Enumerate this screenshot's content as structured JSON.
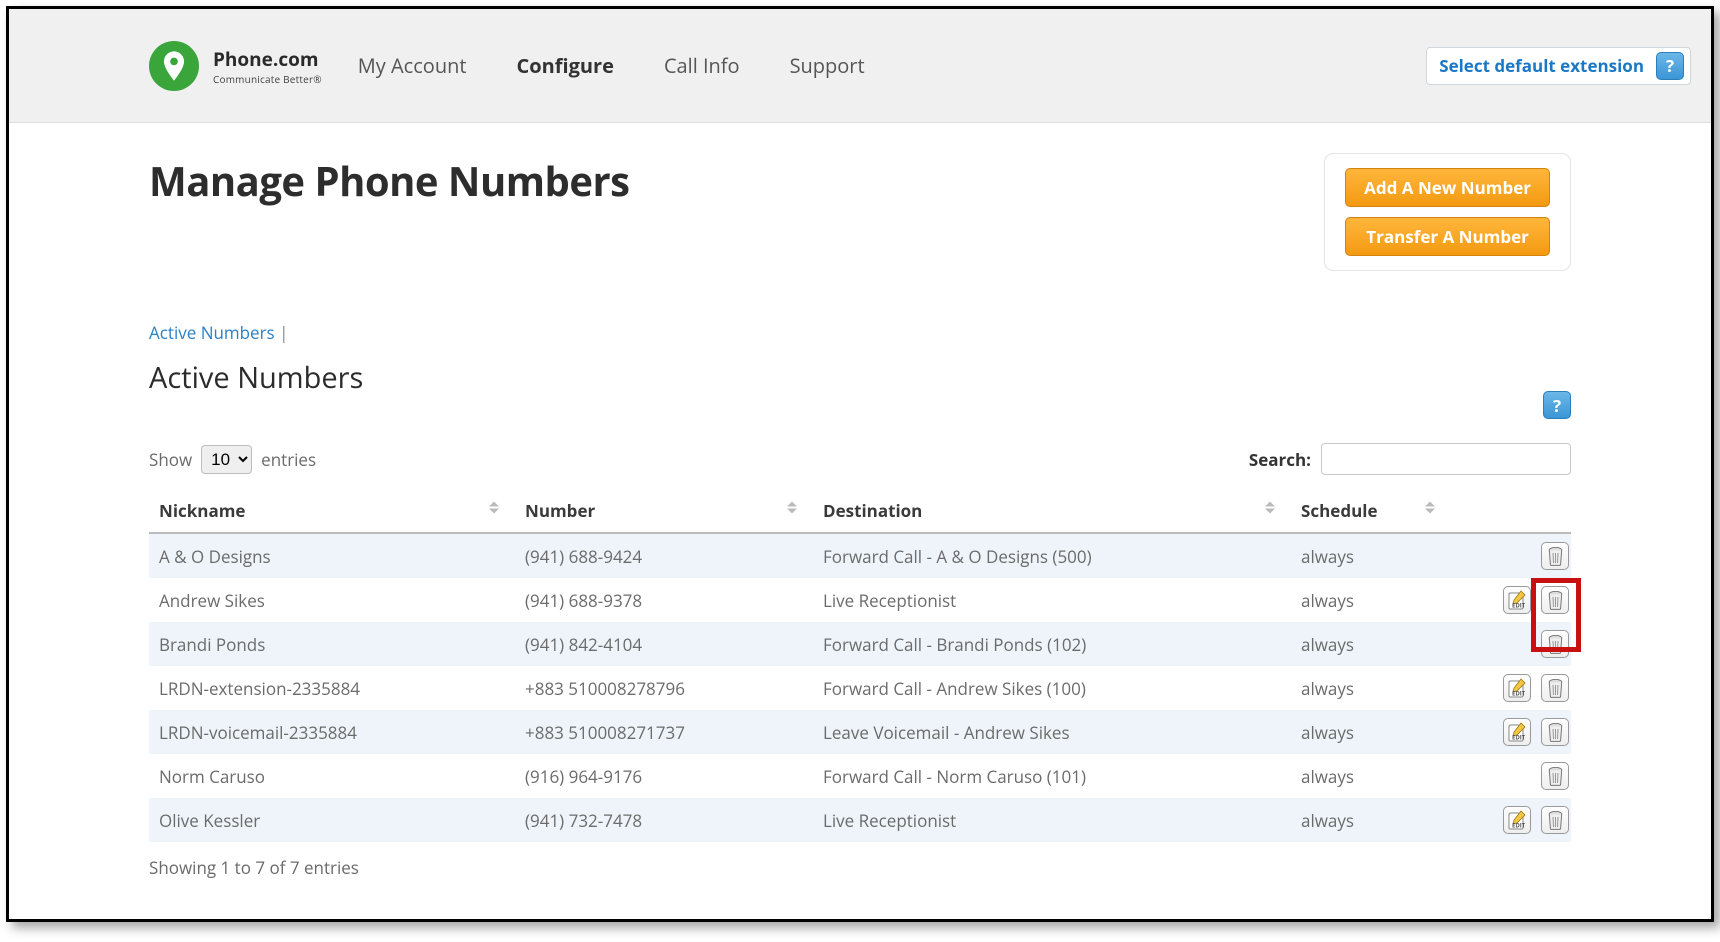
{
  "brand": {
    "name": "Phone.com",
    "tagline": "Communicate Better®"
  },
  "nav": {
    "items": [
      "My Account",
      "Configure",
      "Call Info",
      "Support"
    ],
    "active": "Configure"
  },
  "ext_selector": {
    "label": "Select default extension"
  },
  "page": {
    "title": "Manage Phone Numbers",
    "actions": {
      "add": "Add A New Number",
      "transfer": "Transfer A Number"
    },
    "breadcrumb": {
      "link": "Active Numbers",
      "sep": " | "
    },
    "section": "Active Numbers",
    "show_label_pre": "Show",
    "show_label_post": "entries",
    "show_value": "10",
    "search_label": "Search:",
    "columns": {
      "nick": "Nickname",
      "num": "Number",
      "dest": "Destination",
      "sched": "Schedule"
    },
    "rows": [
      {
        "nick": "A & O Designs",
        "num": "(941) 688-9424",
        "dest": "Forward Call - A & O Designs (500)",
        "sched": "always",
        "edit": false,
        "del": true
      },
      {
        "nick": "Andrew Sikes",
        "num": "(941) 688-9378",
        "dest": "Live Receptionist",
        "sched": "always",
        "edit": true,
        "del": true
      },
      {
        "nick": "Brandi Ponds",
        "num": "(941) 842-4104",
        "dest": "Forward Call - Brandi Ponds (102)",
        "sched": "always",
        "edit": false,
        "del": true
      },
      {
        "nick": "LRDN-extension-2335884",
        "num": "+883 510008278796",
        "dest": "Forward Call - Andrew Sikes (100)",
        "sched": "always",
        "edit": true,
        "del": true
      },
      {
        "nick": "LRDN-voicemail-2335884",
        "num": "+883 510008271737",
        "dest": "Leave Voicemail - Andrew Sikes",
        "sched": "always",
        "edit": true,
        "del": true
      },
      {
        "nick": "Norm Caruso",
        "num": "(916) 964-9176",
        "dest": "Forward Call - Norm Caruso (101)",
        "sched": "always",
        "edit": false,
        "del": true
      },
      {
        "nick": "Olive Kessler",
        "num": "(941) 732-7478",
        "dest": "Live Receptionist",
        "sched": "always",
        "edit": true,
        "del": true
      }
    ],
    "footer": "Showing 1 to 7 of 7 entries"
  }
}
